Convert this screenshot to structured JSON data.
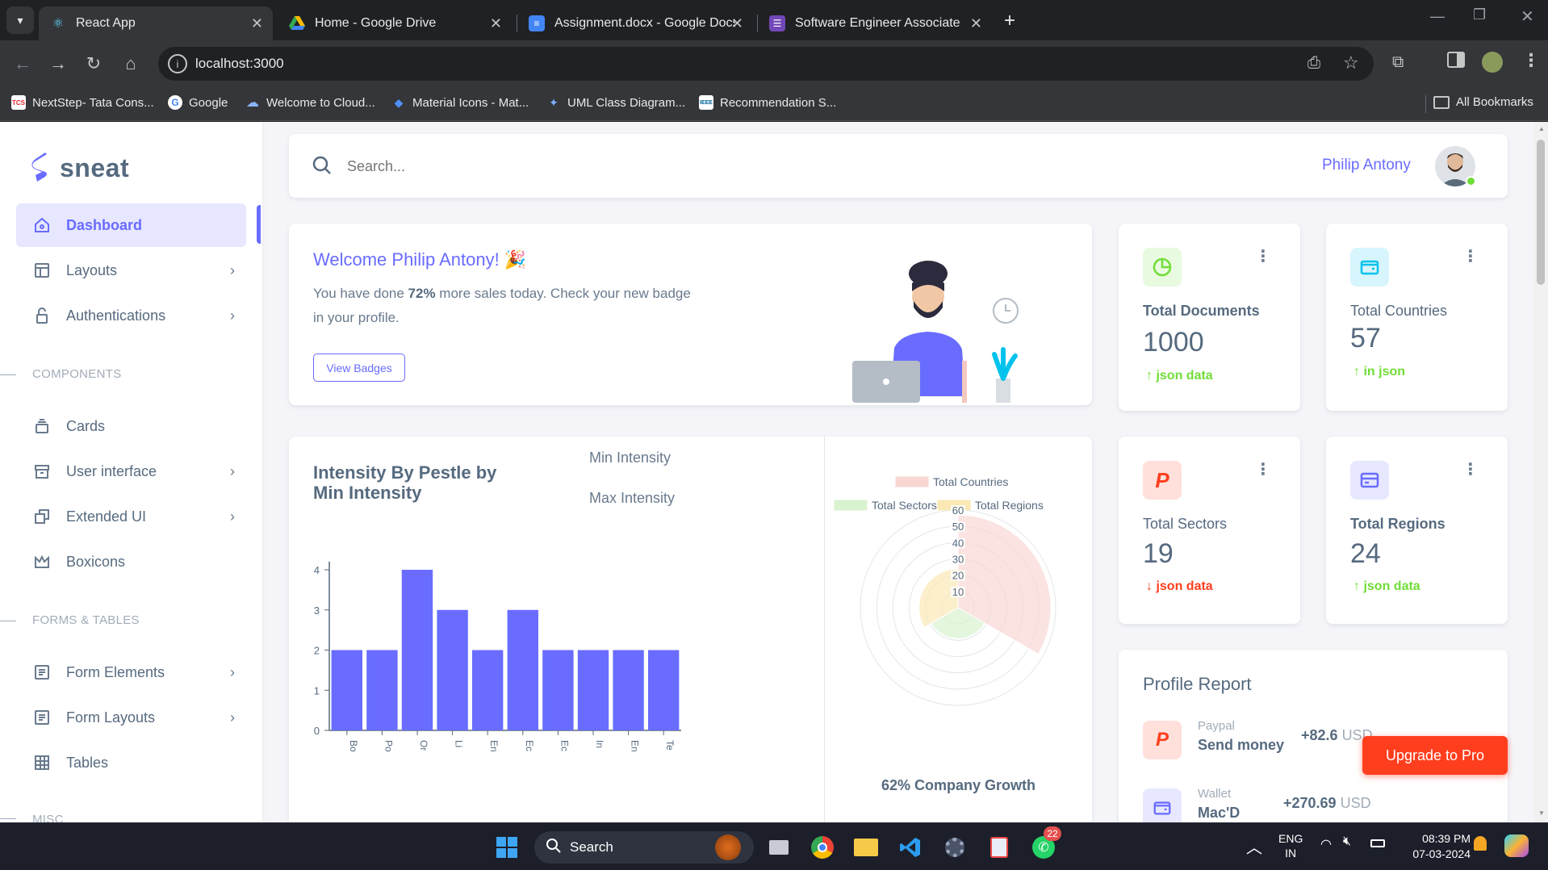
{
  "browser": {
    "tabs": [
      {
        "title": "React App",
        "icon": "react-icon",
        "color": "#61dafb"
      },
      {
        "title": "Home - Google Drive",
        "icon": "drive-icon",
        "color": "#34a853"
      },
      {
        "title": "Assignment.docx - Google Docs",
        "icon": "docs-icon",
        "color": "#4285f4"
      },
      {
        "title": "Software Engineer Associate",
        "icon": "forms-icon",
        "color": "#7248b9"
      }
    ],
    "url": "localhost:3000",
    "bookmarks": [
      {
        "label": "NextStep- Tata Cons...",
        "badge": "TCS"
      },
      {
        "label": "Google",
        "badge": "G"
      },
      {
        "label": "Welcome to Cloud...",
        "badge": ""
      },
      {
        "label": "Material Icons - Mat...",
        "badge": ""
      },
      {
        "label": "UML Class Diagram...",
        "badge": ""
      },
      {
        "label": "Recommendation S...",
        "badge": "IEEE"
      }
    ],
    "all_bookmarks": "All Bookmarks"
  },
  "sidebar": {
    "brand": "sneat",
    "items": [
      {
        "label": "Dashboard",
        "icon": "home-icon"
      },
      {
        "label": "Layouts",
        "icon": "layout-icon"
      },
      {
        "label": "Authentications",
        "icon": "lock-icon"
      },
      {
        "label": "Cards",
        "icon": "cards-icon"
      },
      {
        "label": "User interface",
        "icon": "box-icon"
      },
      {
        "label": "Extended UI",
        "icon": "copy-icon"
      },
      {
        "label": "Boxicons",
        "icon": "crown-icon"
      },
      {
        "label": "Form Elements",
        "icon": "form-icon"
      },
      {
        "label": "Form Layouts",
        "icon": "form-layout-icon"
      },
      {
        "label": "Tables",
        "icon": "table-icon"
      }
    ],
    "sections": [
      "COMPONENTS",
      "FORMS & TABLES",
      "MISC"
    ]
  },
  "header": {
    "search_placeholder": "Search...",
    "user_name": "Philip Antony"
  },
  "welcome": {
    "title": "Welcome Philip Antony! 🎉",
    "text_pre": "You have done ",
    "text_bold": "72%",
    "text_post": " more sales today. Check your new badge in your profile.",
    "button": "View Badges"
  },
  "kpis": [
    {
      "label": "Total Documents",
      "value": "1000",
      "trend": "json data",
      "dir": "up",
      "icon": "pie-icon",
      "bg": "#e8fadf",
      "fg": "#71dd37"
    },
    {
      "label": "Total Countries",
      "value": "57",
      "trend": "in json",
      "dir": "up",
      "icon": "wallet-icon",
      "bg": "#d7f5fc",
      "fg": "#03c3ec"
    },
    {
      "label": "Total Sectors",
      "value": "19",
      "trend": "json data",
      "dir": "down",
      "icon": "paypal-icon",
      "bg": "#ffe0db",
      "fg": "#ff3e1d"
    },
    {
      "label": "Total Regions",
      "value": "24",
      "trend": "json data",
      "dir": "up",
      "icon": "credit-card-icon",
      "bg": "#e7e7ff",
      "fg": "#696cff"
    }
  ],
  "bar_card": {
    "title": "Intensity By Pestle by Min Intensity",
    "legend": [
      "Min Intensity",
      "Max Intensity"
    ]
  },
  "polar_card": {
    "legend": [
      "Total Countries",
      "Total Sectors",
      "Total Regions"
    ],
    "caption": "62% Company Growth"
  },
  "profile_report": {
    "title": "Profile Report",
    "rows": [
      {
        "source": "Paypal",
        "desc": "Send money",
        "amount": "+82.6",
        "unit": "USD",
        "icon": "paypal-icon"
      },
      {
        "source": "Wallet",
        "desc": "Mac'D",
        "amount": "+270.69",
        "unit": "USD",
        "icon": "wallet-icon"
      }
    ]
  },
  "upgrade_button": "Upgrade to Pro",
  "taskbar": {
    "search": "Search",
    "lang1": "ENG",
    "lang2": "IN",
    "time": "08:39 PM",
    "date": "07-03-2024",
    "whatsapp_badge": "22"
  },
  "chart_data": [
    {
      "type": "bar",
      "title": "Intensity By Pestle by Min Intensity",
      "categories": [
        "Bo",
        "Po",
        "Or",
        "Li",
        "En",
        "Ec",
        "Ec",
        "In",
        "En",
        "Te"
      ],
      "series": [
        {
          "name": "Min Intensity",
          "values": [
            2,
            2,
            4,
            3,
            2,
            3,
            2,
            2,
            2,
            2
          ]
        }
      ],
      "ylim": [
        0,
        4
      ],
      "yticks": [
        0,
        1,
        2,
        3,
        4
      ],
      "color": "#696cff"
    },
    {
      "type": "polar-area",
      "categories": [
        "Total Countries",
        "Total Sectors",
        "Total Regions"
      ],
      "values": [
        57,
        19,
        24
      ],
      "colors": [
        "#f8d7d3",
        "#d9f2d0",
        "#fbe8b5"
      ],
      "rlim": [
        0,
        60
      ],
      "rticks": [
        10,
        20,
        30,
        40,
        50,
        60
      ]
    }
  ]
}
